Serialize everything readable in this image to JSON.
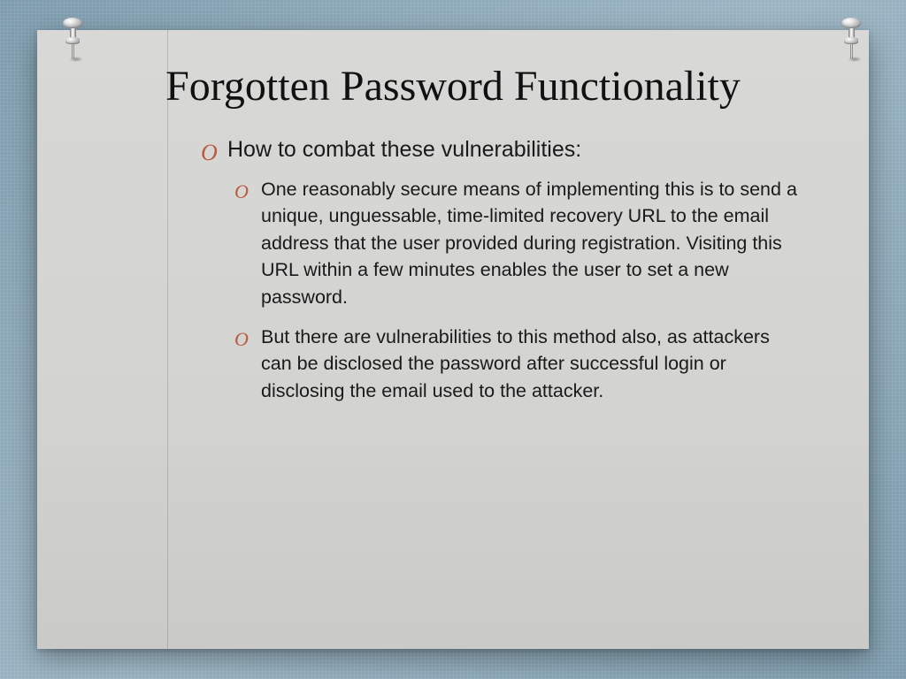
{
  "slide": {
    "title": "Forgotten Password Functionality",
    "heading": "How to combat these vulnerabilities:",
    "bullets": [
      "One reasonably secure means of implementing this is to send a unique, unguessable, time-limited recovery URL to the email address that the user provided during registration. Visiting this URL within a few minutes enables the user to set a new password.",
      "But there are vulnerabilities to this method also, as attackers can be disclosed the password after successful login or disclosing the email used to the attacker."
    ],
    "bullet_glyph": "O"
  }
}
